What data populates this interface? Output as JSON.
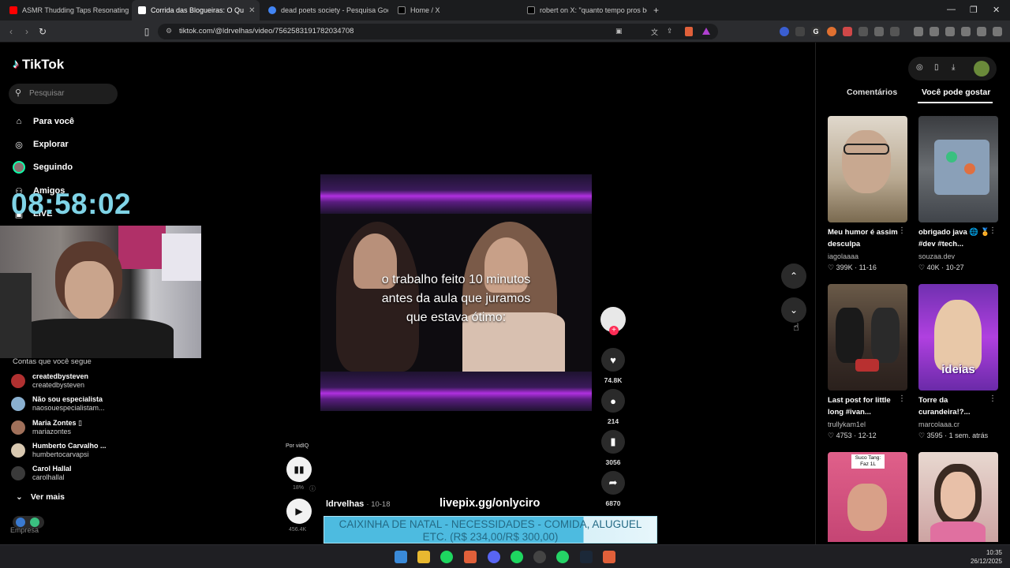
{
  "browser": {
    "tabs": [
      {
        "label": "ASMR Thudding Taps Resonating in",
        "favicon": "youtube-icon",
        "color": "#ff0000"
      },
      {
        "label": "Corrida das Blogueiras: O Qu",
        "favicon": "tiktok-icon",
        "color": "#ffffff",
        "active": true
      },
      {
        "label": "dead poets society - Pesquisa Google",
        "favicon": "google-icon",
        "color": "#4285f4"
      },
      {
        "label": "Home / X",
        "favicon": "x-icon",
        "color": "#ffffff"
      },
      {
        "label": "robert on X: \"quanto tempo pros bol",
        "favicon": "x-icon",
        "color": "#ffffff"
      }
    ],
    "url": "tiktok.com/@ldrvelhas/video/7562583191782034708"
  },
  "sidebar": {
    "logo": "TikTok",
    "search_placeholder": "Pesquisar",
    "nav": [
      {
        "label": "Para você",
        "icon": "home-icon"
      },
      {
        "label": "Explorar",
        "icon": "compass-icon"
      },
      {
        "label": "Seguindo",
        "icon": "following-avatar-icon"
      },
      {
        "label": "Amigos",
        "icon": "friends-icon"
      },
      {
        "label": "LIVE",
        "icon": "live-icon"
      }
    ],
    "clock": "08:58:02",
    "following_header": "Contas que você segue",
    "following": [
      {
        "name": "createdbysteven",
        "handle": "createdbysteven",
        "color": "#b03030"
      },
      {
        "name": "Não sou especialista",
        "handle": "naosouespecialistam...",
        "color": "#8ab0d0"
      },
      {
        "name": "Maria Zontes ▯",
        "handle": "mariazontes",
        "color": "#a0705a"
      },
      {
        "name": "Humberto Carvalho ...",
        "handle": "humbertocarvapsi",
        "color": "#d8c8b0"
      },
      {
        "name": "Carol Hallal",
        "handle": "carolhallal",
        "color": "#3a3a3a"
      }
    ],
    "see_more": "Ver mais",
    "footer_label": "Empresa"
  },
  "video": {
    "caption_lines": [
      "o trabalho feito 10 minutos",
      "antes da aula que juramos",
      "que estava ótimo:"
    ],
    "author": "ldrvelhas",
    "date": "10-18",
    "stats": {
      "likes": "74.8K",
      "comments": "214",
      "saves": "3056",
      "shares": "6870"
    },
    "vidiq_label": "Por vidIQ",
    "vidiq_percent": "18%",
    "views": "456.4K"
  },
  "stream_overlay": {
    "livepix": "livepix.gg/onlyciro",
    "donation_line1": "CAIXINHA DE NATAL - NECESSIDADES - COMIDA, ALUGUEL",
    "donation_line2": "ETC. (R$ 234,00/R$ 300,00)",
    "donation_progress": 0.78
  },
  "right_panel": {
    "tabs": [
      "Comentários",
      "Você pode gostar"
    ],
    "active_tab": "Você pode gostar",
    "cards": [
      {
        "title": "Meu humor é assim desculpa",
        "user": "iagolaaaa",
        "stats": "♡ 399K · 11-16",
        "thumb": "#b8a890"
      },
      {
        "title": "obrigado java 🌐 🏅 #dev #tech...",
        "user": "souzaa.dev",
        "stats": "♡ 40K · 10-27",
        "thumb": "#5a5e62"
      },
      {
        "title": "Last post for little long #ivan...",
        "user": "trullykam1el",
        "stats": "♡ 4753 · 12-12",
        "thumb": "#4a3a32"
      },
      {
        "title": "Torre da curandeira!?...",
        "user": "marcolaaa.cr",
        "stats": "♡ 3595 · 1 sem. atrás",
        "thumb": "#9a3ad0"
      },
      {
        "title": "",
        "user": "",
        "stats": "",
        "thumb": "#d0608a",
        "overlay": "Suco Tang: Faz 1L"
      },
      {
        "title": "",
        "user": "",
        "stats": "",
        "thumb": "#c89a9a"
      }
    ],
    "card_overlay_text": "ideias"
  },
  "taskbar": {
    "time": "10:35",
    "date": "26/12/2025"
  }
}
